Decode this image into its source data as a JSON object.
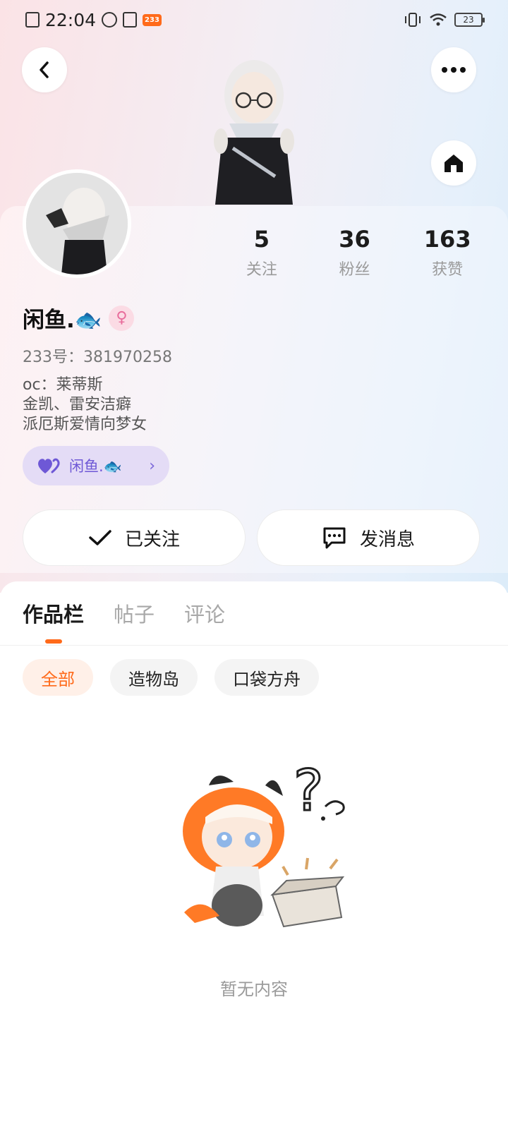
{
  "status_bar": {
    "time": "22:04",
    "app_badge": "233",
    "battery": "23"
  },
  "header": {
    "back_icon": "back-chevron-icon",
    "more_icon": "more-dots-icon",
    "home_icon": "home-icon"
  },
  "profile": {
    "name": "闲鱼.🐟",
    "uid": "233号：381970258",
    "bio": [
      "oc：莱蒂斯",
      "金凯、雷安洁癖",
      "派厄斯爱情向梦女"
    ],
    "tag_label": "闲鱼.🐟",
    "stats": [
      {
        "num": "5",
        "label": "关注"
      },
      {
        "num": "36",
        "label": "粉丝"
      },
      {
        "num": "163",
        "label": "获赞"
      }
    ]
  },
  "actions": {
    "follow_label": "已关注",
    "message_label": "发消息"
  },
  "tabs": [
    "作品栏",
    "帖子",
    "评论"
  ],
  "filters": [
    "全部",
    "造物岛",
    "口袋方舟"
  ],
  "empty": {
    "text": "暂无内容"
  },
  "colors": {
    "accent": "#ff6a1a",
    "tag_bg": "#e4dcf6",
    "tag_text": "#6e58d6"
  }
}
